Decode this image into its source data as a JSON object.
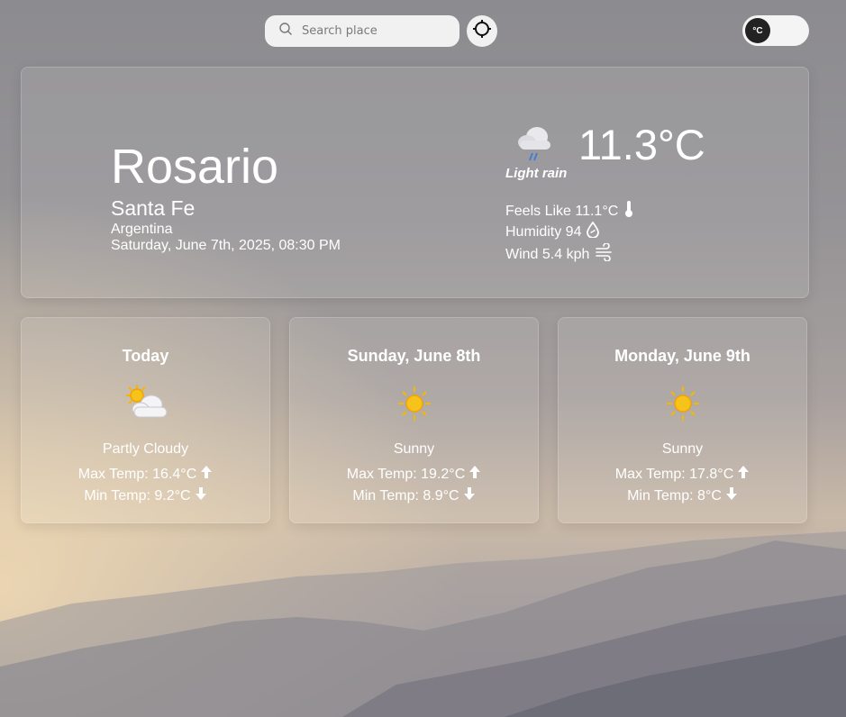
{
  "search": {
    "placeholder": "Search place"
  },
  "unit_toggle": {
    "label": "°C"
  },
  "current": {
    "city": "Rosario",
    "region": "Santa Fe",
    "country": "Argentina",
    "datetime": "Saturday, June 7th, 2025, 08:30 PM",
    "temperature": "11.3°C",
    "condition": "Light rain",
    "condition_icon": "rain-cloud-icon",
    "feels_like": "Feels Like 11.1°C",
    "humidity": "Humidity 94",
    "wind": "Wind 5.4 kph"
  },
  "forecast": [
    {
      "day": "Today",
      "condition": "Partly Cloudy",
      "icon": "partly-cloudy-icon",
      "max": "Max Temp: 16.4°C",
      "min": "Min Temp: 9.2°C"
    },
    {
      "day": "Sunday, June 8th",
      "condition": "Sunny",
      "icon": "sun-icon",
      "max": "Max Temp: 19.2°C",
      "min": "Min Temp: 8.9°C"
    },
    {
      "day": "Monday, June 9th",
      "condition": "Sunny",
      "icon": "sun-icon",
      "max": "Max Temp: 17.8°C",
      "min": "Min Temp: 8°C"
    }
  ],
  "colors": {
    "text": "#ffffff",
    "sun": "#f5b800",
    "rain": "#3f7fd6"
  }
}
